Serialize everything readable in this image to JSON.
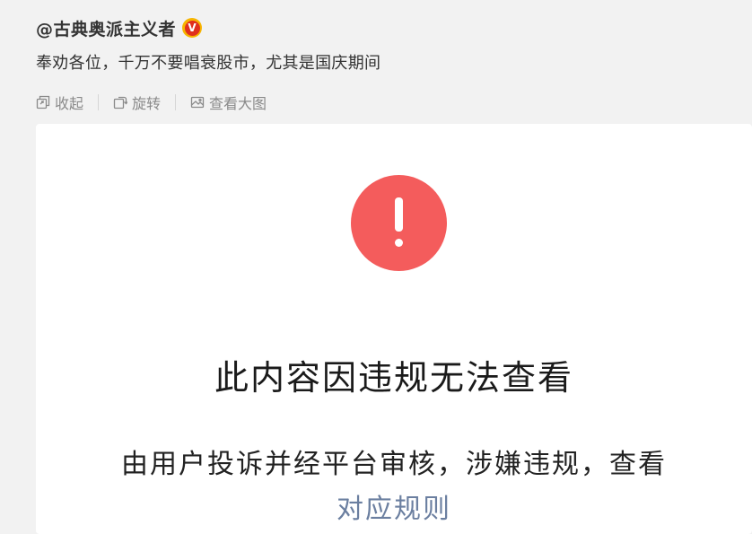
{
  "author": {
    "name": "@古典奥派主义者",
    "verified_badge_text": "V",
    "badge_color": "#f7b500"
  },
  "post": {
    "text": "奉劝各位，千万不要唱衰股市，尤其是国庆期间"
  },
  "toolbar": {
    "collapse_label": "收起",
    "collapse_icon": "collapse-icon",
    "rotate_label": "旋转",
    "rotate_icon": "rotate-icon",
    "view_large_label": "查看大图",
    "view_large_icon": "image-icon"
  },
  "notice": {
    "icon": "warning-icon",
    "icon_color": "#f45c5c",
    "title": "此内容因违规无法查看",
    "description": "由用户投诉并经平台审核，涉嫌违规，查看",
    "link_text": "对应规则",
    "link_color": "#6b7fa0"
  }
}
